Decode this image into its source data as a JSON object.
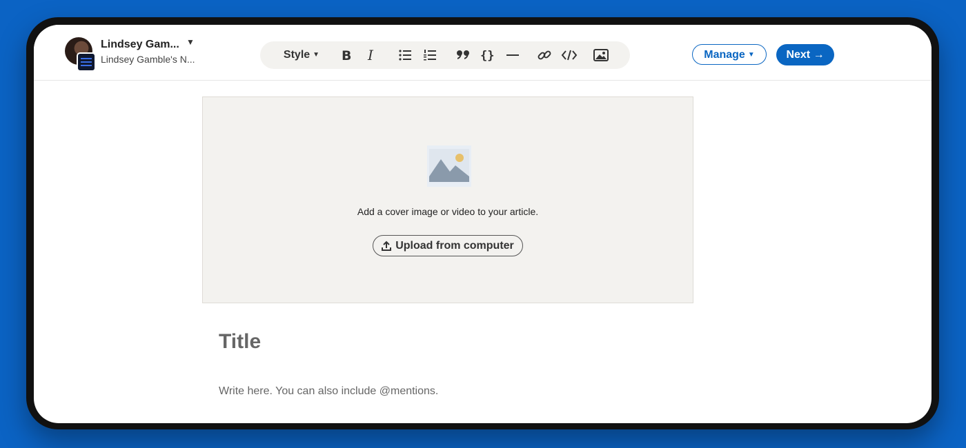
{
  "profile": {
    "name": "Lindsey Gam...",
    "subtitle": "Lindsey Gamble's N..."
  },
  "toolbar": {
    "style_label": "Style",
    "icons": [
      "bold-icon",
      "italic-icon",
      "bulleted-list-icon",
      "numbered-list-icon",
      "quote-icon",
      "code-block-icon",
      "divider-icon",
      "link-icon",
      "embed-code-icon",
      "image-icon"
    ]
  },
  "header": {
    "manage_label": "Manage",
    "next_label": "Next →"
  },
  "cover": {
    "prompt": "Add a cover image or video to your article.",
    "upload_label": "Upload from computer"
  },
  "editor": {
    "title_placeholder": "Title",
    "body_placeholder": "Write here. You can also include @mentions."
  },
  "colors": {
    "accent": "#0a66c2",
    "background": "#0b63c4",
    "cover_bg": "#f3f2ef"
  }
}
